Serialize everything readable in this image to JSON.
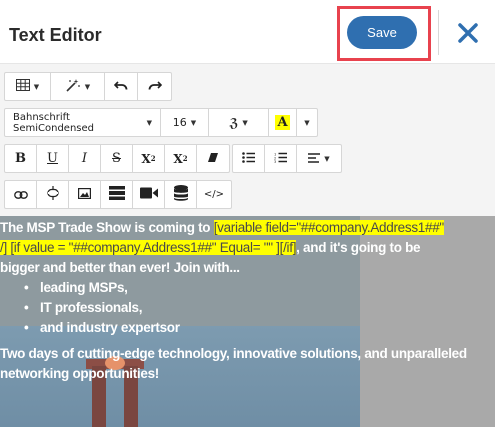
{
  "header": {
    "title": "Text Editor",
    "save_label": "Save"
  },
  "toolbar": {
    "font_family": "Bahnschrift SemiCondensed",
    "font_size": "16",
    "highlight_glyph": "A",
    "buttons_row1": [
      "table-icon",
      "magic-wand-icon",
      "undo-icon",
      "redo-icon"
    ],
    "buttons_row3": [
      "bold-icon",
      "underline-icon",
      "italic-icon",
      "strikethrough-icon",
      "superscript-icon",
      "subscript-icon",
      "clear-format-icon",
      "bullet-list-icon",
      "numbered-list-icon",
      "align-icon"
    ],
    "buttons_row4": [
      "link-icon",
      "unlink-icon",
      "image-icon",
      "table-layout-icon",
      "video-icon",
      "database-icon",
      "code-view-icon"
    ],
    "labels": {
      "bold": "B",
      "underline": "U",
      "italic": "I",
      "strike": "S",
      "superscript": "X",
      "subscript": "X",
      "code": "</>"
    }
  },
  "content": {
    "line1_prefix": "The MSP Trade Show is coming to ",
    "line1_tag": "[variable field=\"##company.Address1##\"",
    "line2_tag": "/] [if value = \"##company.Address1##\" Equal= \"\" ][/if]",
    "line2_suffix": ", and it's going to be",
    "line3": "bigger and better than ever! Join with...",
    "bullets": [
      "leading MSPs,",
      "IT professionals,",
      "and industry expertsor"
    ],
    "para2_line1": "Two days of cutting-edge technology, innovative solutions, and unparalleled",
    "para2_line2": "networking opportunities!"
  },
  "colors": {
    "save_button": "#2f6fb0",
    "save_highlight_box": "#e8424e",
    "close_icon": "#2f6fb0",
    "variable_highlight": "#ffff00"
  }
}
